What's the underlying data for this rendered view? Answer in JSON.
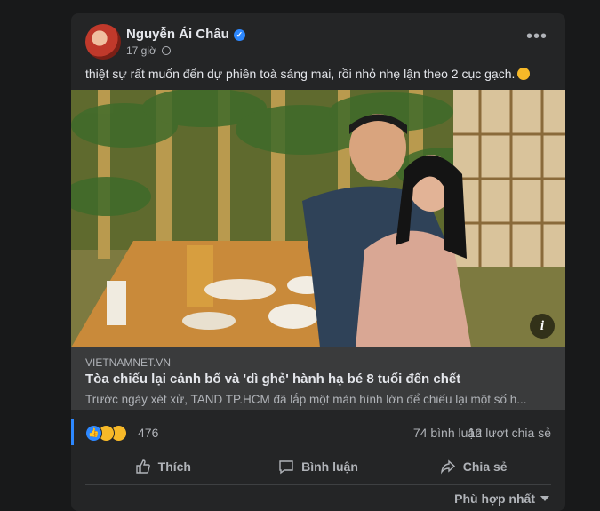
{
  "post": {
    "author": "Nguyễn Ái Châu",
    "time": "17 giờ",
    "text": "thiệt sự rất muốn đến dự phiên toà sáng mai, rồi nhỏ nhẹ lận theo 2 cục gạch."
  },
  "link": {
    "domain": "VIETNAMNET.VN",
    "title": "Tòa chiếu lại cảnh bố và 'dì ghẻ' hành hạ bé 8 tuổi đến chết",
    "description": "Trước ngày xét xử, TAND TP.HCM đã lắp một màn hình lớn để chiếu lại một số h..."
  },
  "stats": {
    "reaction_count": "476",
    "comments": "74 bình luận",
    "shares": "12 lượt chia sẻ"
  },
  "actions": {
    "like": "Thích",
    "comment": "Bình luận",
    "share": "Chia sẻ"
  },
  "sort_label": "Phù hợp nhất",
  "icons": [
    "verified-icon",
    "globe-icon",
    "more-icon",
    "info-icon",
    "like-reaction-icon",
    "haha-reaction-icon",
    "sad-reaction-icon",
    "like-icon",
    "comment-icon",
    "share-icon",
    "caret-down-icon"
  ],
  "colors": {
    "accent": "#2d88ff",
    "card_bg": "#242526",
    "link_bg": "#3a3b3c",
    "reaction_yellow": "#f7b928"
  }
}
